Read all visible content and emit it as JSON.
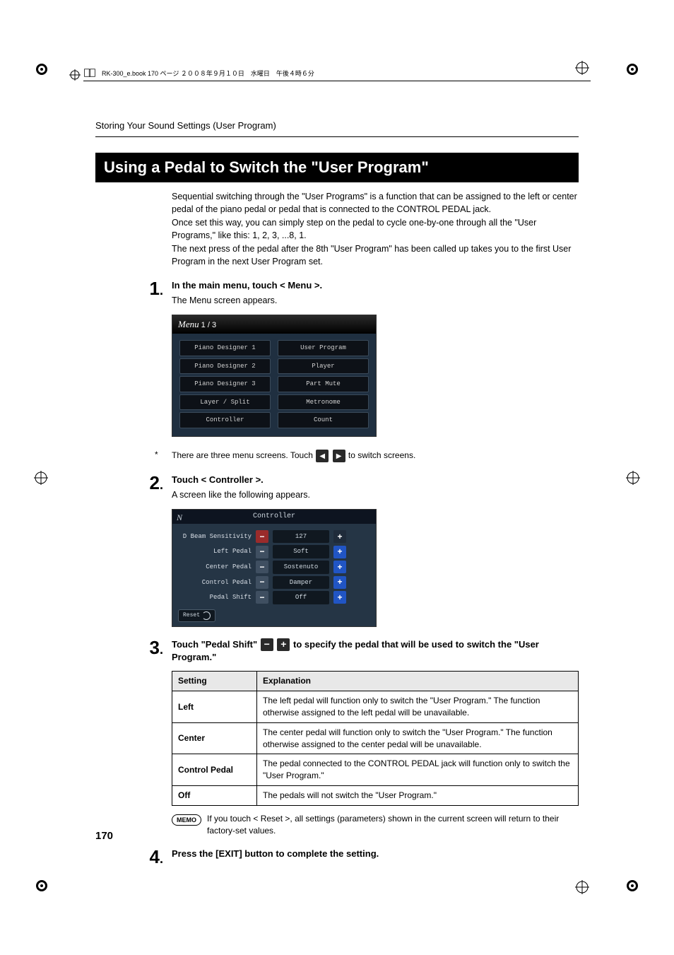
{
  "header_line": "RK-300_e.book  170 ページ  ２００８年９月１０日　水曜日　午後４時６分",
  "running_head": "Storing Your Sound Settings (User Program)",
  "title": "Using a Pedal to Switch the \"User Program\"",
  "intro": [
    "Sequential switching through the \"User Programs\" is a function that can be assigned to the left or center pedal of the piano pedal or pedal that is connected to the CONTROL PEDAL jack.",
    "Once set this way, you can simply step on the pedal to cycle one-by-one through all the \"User Programs,\" like this: 1, 2, 3, ...8, 1.",
    "The next press of the pedal after the 8th \"User Program\" has been called up takes you to the first User Program in the next User Program set."
  ],
  "steps": {
    "s1": {
      "num": "1",
      "title": "In the main menu, touch < Menu >.",
      "line": "The Menu screen appears."
    },
    "s2": {
      "num": "2",
      "title": "Touch < Controller >.",
      "line": "A screen like the following appears."
    },
    "s3": {
      "num": "3",
      "title_before": "Touch \"Pedal Shift\" ",
      "title_after": " to specify the pedal that will be used to switch the \"User Program.\""
    },
    "s4": {
      "num": "4",
      "title": "Press the [EXIT] button to complete the setting."
    }
  },
  "menu_screen": {
    "title_prefix": "Menu",
    "title_suffix": " 1 / 3",
    "rows": [
      [
        "Piano Designer 1",
        "User Program"
      ],
      [
        "Piano Designer 2",
        "Player"
      ],
      [
        "Piano Designer 3",
        "Part Mute"
      ],
      [
        "Layer / Split",
        "Metronome"
      ],
      [
        "Controller",
        "Count"
      ]
    ]
  },
  "note": {
    "ast": "*",
    "before": "There are three menu screens. Touch ",
    "after": " to switch screens."
  },
  "ctrl_screen": {
    "title": "Controller",
    "mark": "N",
    "rows": [
      {
        "label": "D Beam Sensitivity",
        "value": "127",
        "minus_style": "red",
        "plus_style": ""
      },
      {
        "label": "Left Pedal",
        "value": "Soft",
        "minus_style": "",
        "plus_style": "on"
      },
      {
        "label": "Center Pedal",
        "value": "Sostenuto",
        "minus_style": "",
        "plus_style": "on"
      },
      {
        "label": "Control Pedal",
        "value": "Damper",
        "minus_style": "",
        "plus_style": "on"
      },
      {
        "label": "Pedal Shift",
        "value": "Off",
        "minus_style": "",
        "plus_style": "on"
      }
    ],
    "reset": "Reset"
  },
  "table": {
    "head": [
      "Setting",
      "Explanation"
    ],
    "rows": [
      [
        "Left",
        "The left pedal will function only to switch the \"User Program.\" The function otherwise assigned to the left pedal will be unavailable."
      ],
      [
        "Center",
        "The center pedal will function only to switch the \"User Program.\" The function otherwise assigned to the center pedal will be unavailable."
      ],
      [
        "Control Pedal",
        "The pedal connected to the CONTROL PEDAL jack will function only to switch the \"User Program.\""
      ],
      [
        "Off",
        "The pedals will not switch the \"User Program.\""
      ]
    ]
  },
  "memo": {
    "badge": "MEMO",
    "text": "If you touch < Reset >, all settings (parameters) shown in the current screen will return to their factory-set values."
  },
  "page_num": "170"
}
